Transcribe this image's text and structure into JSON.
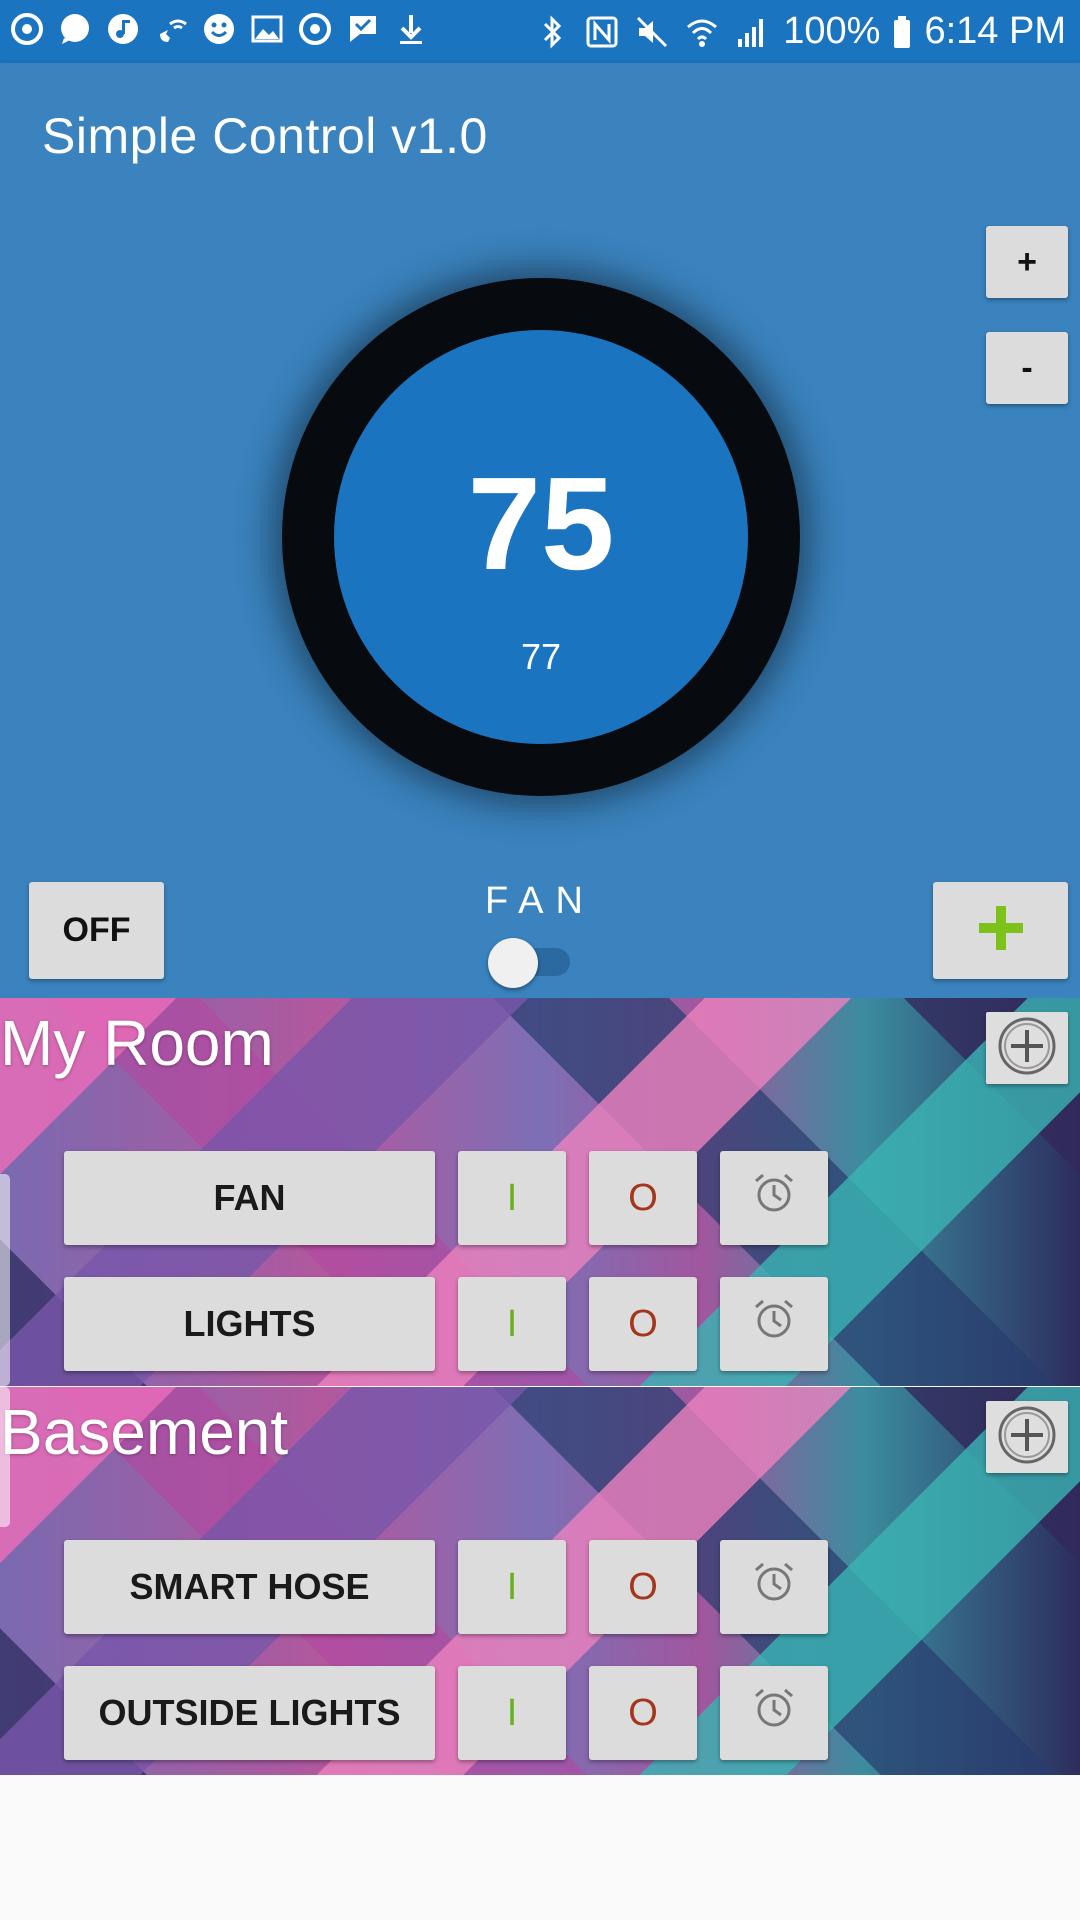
{
  "status_bar": {
    "left_icons": [
      "sync-icon",
      "chat-bubble-icon",
      "music-note-icon",
      "wifi-call-icon",
      "smiley-icon",
      "gallery-icon",
      "sync-icon",
      "check-flag-icon",
      "download-icon"
    ],
    "right_icons": [
      "bluetooth-icon",
      "nfc-icon",
      "mute-icon",
      "wifi-icon",
      "signal-icon",
      "battery-icon"
    ],
    "battery": "100%",
    "time": "6:14 PM"
  },
  "app": {
    "title": "Simple Control v1.0"
  },
  "thermostat": {
    "increase_label": "+",
    "decrease_label": "-",
    "setpoint": "75",
    "current_temp": "77",
    "mode_label": "OFF",
    "fan_label": "FAN",
    "fan_on": false,
    "add_room_icon": "plus-icon"
  },
  "rooms": [
    {
      "name": "My Room",
      "devices": [
        {
          "name": "FAN",
          "on_label": "I",
          "off_label": "O"
        },
        {
          "name": "LIGHTS",
          "on_label": "I",
          "off_label": "O"
        }
      ]
    },
    {
      "name": "Basement",
      "devices": [
        {
          "name": "SMART HOSE",
          "on_label": "I",
          "off_label": "O"
        },
        {
          "name": "OUTSIDE LIGHTS",
          "on_label": "I",
          "off_label": "O"
        }
      ]
    }
  ],
  "colors": {
    "status_bar": "#1b74c0",
    "app_bar": "#3a83be",
    "dial_ring": "#070a0e",
    "dial_face": "#1b74c0",
    "on_green": "#6ab023",
    "off_red": "#a3361c",
    "add_green": "#7cc21a"
  }
}
